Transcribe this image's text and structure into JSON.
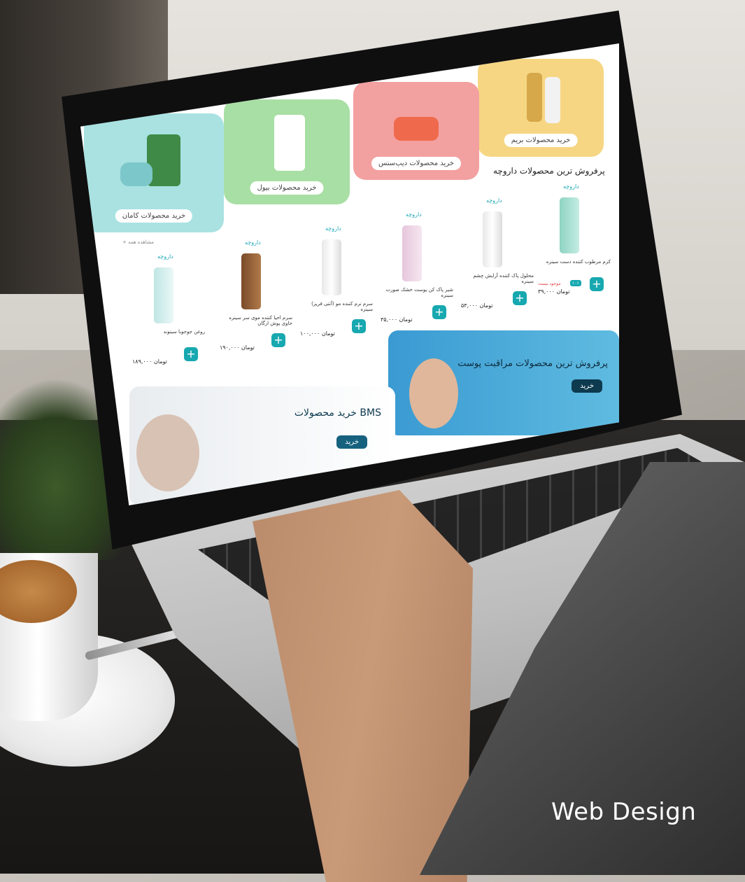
{
  "caption": "Web Design",
  "screen": {
    "tiles": [
      {
        "label": "خرید محصولات بریم",
        "color": "#f6d683"
      },
      {
        "label": "خرید محصولات دیپ‌سنس",
        "color": "#f3a0a0"
      },
      {
        "label": "خرید محصولات بیول",
        "color": "#a8dfa4"
      },
      {
        "label": "خرید محصولات کامان",
        "color": "#a9e2e1"
      }
    ],
    "section_title": "پرفروش ترین محصولات داروچه",
    "see_all": "+ مشاهده همه",
    "brand": "داروچه",
    "products": [
      {
        "name": "کرم مرطوب کننده دست سینره",
        "old_price": "موجود نیست",
        "badge": "۱۰٪",
        "price": "۳۹,۰۰۰ تومان"
      },
      {
        "name": "محلول پاک کننده آرایش چشم سینره",
        "price": "۵۳,۰۰۰ تومان"
      },
      {
        "name": "شیر پاک کن پوست خشک صورت سینره",
        "price": "۳۵,۰۰۰ تومان"
      },
      {
        "name": "سرم نرم کننده مو (آنتی فریز) سینره",
        "price": "۱۰۰,۰۰۰ تومان"
      },
      {
        "name": "سرم احیا کننده موی سر سینره حاوی پوش ارگان",
        "price": "۱۹۰,۰۰۰ تومان"
      },
      {
        "name": "روغن جوجوبا سینوند",
        "price": "۱۸۹,۰۰۰ تومان"
      }
    ],
    "banner_skincare": {
      "text": "پرفروش ترین محصولات مراقبت پوست",
      "button": "خرید"
    },
    "banner_bms": {
      "text": "خرید محصولات BMS",
      "button": "خرید"
    }
  },
  "colors": {
    "accent": "#17a8b0",
    "dark": "#0d3a4f"
  }
}
